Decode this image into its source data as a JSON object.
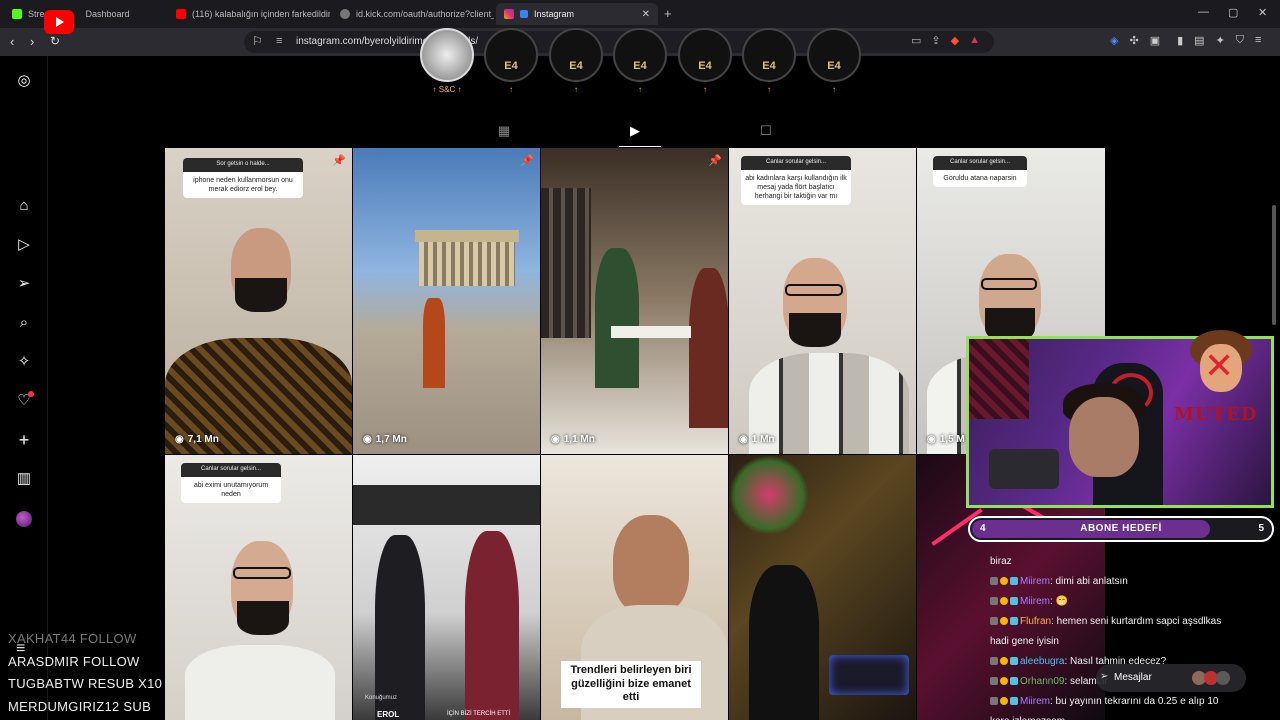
{
  "browser": {
    "tabs": [
      {
        "label": "Strea",
        "label2": "Dashboard",
        "favicon_color": "#53fc18"
      },
      {
        "label": "(116) kalabalığın içinden farkedildin -",
        "favicon_color": "#ff0000"
      },
      {
        "label": "id.kick.com/oauth/authorize?client_id",
        "favicon_color": "#888888"
      },
      {
        "label": "Instagram",
        "favicon_color": "#e1306c"
      }
    ],
    "close_glyph": "✕",
    "new_tab_glyph": "+",
    "url": "instagram.com/byerolyildirimofficial/reels/",
    "window_controls": [
      "—",
      "▢",
      "✕"
    ]
  },
  "instagram": {
    "sidebar_icons": [
      "instagram-icon",
      "home-icon",
      "reels-icon",
      "direct-icon",
      "search-icon",
      "explore-icon",
      "heart-icon",
      "create-icon",
      "dashboard-icon"
    ],
    "highlights": [
      {
        "label": "S&C",
        "cover": ""
      },
      {
        "label": "",
        "cover": "E4"
      },
      {
        "label": "",
        "cover": "E4"
      },
      {
        "label": "",
        "cover": "E4"
      },
      {
        "label": "",
        "cover": "E4"
      },
      {
        "label": "",
        "cover": "E4"
      },
      {
        "label": "",
        "cover": "E4"
      }
    ],
    "profile_tabs": [
      "posts-tab",
      "reels-tab",
      "tagged-tab"
    ],
    "reels": [
      {
        "views": "7,1 Mn",
        "pinned": true,
        "card_head": "Sor getsin o halde...",
        "card_text": "iphone neden kullanmorsun onu merak ediorz erol bey."
      },
      {
        "views": "1,7 Mn",
        "pinned": true,
        "card_head": "",
        "card_text": ""
      },
      {
        "views": "1,1 Mn",
        "pinned": true,
        "card_head": "",
        "card_text": ""
      },
      {
        "views": "1 Mn",
        "pinned": false,
        "card_head": "Canlar sorular gelsin...",
        "card_text": "abi kadınlara karşı kullandığın ilk mesaj yada flört başlatıcı herhangi bir taktiğin var mı"
      },
      {
        "views": "1,5 M",
        "pinned": false,
        "card_head": "Canlar sorular gelsin...",
        "card_text": "Goruldu atana naparsin"
      },
      {
        "views": "",
        "pinned": false,
        "card_head": "Canlar sorular gelsin...",
        "card_text": "abi eximi unutamıyorum neden"
      },
      {
        "views": "",
        "pinned": false,
        "card_head": "",
        "card_text": "",
        "small_text": "Konuğumuz",
        "name_text": "EROL",
        "right_text": "İÇİN BİZİ TERCİH ETTİ"
      },
      {
        "views": "",
        "pinned": false,
        "card_head": "",
        "card_text": "",
        "banner": "Trendleri belirleyen biri güzelliğini bize emanet etti"
      },
      {
        "views": "",
        "pinned": false,
        "card_head": "",
        "card_text": ""
      },
      {
        "views": "",
        "pinned": false,
        "card_head": "",
        "card_text": ""
      }
    ]
  },
  "stream": {
    "muted_text": "MUTED",
    "goal": {
      "title": "ABONE HEDEFİ",
      "current": "4",
      "target": "5",
      "progress": 0.8
    },
    "chat": [
      {
        "user": "",
        "user_color": "#ffffff",
        "text": "biraz"
      },
      {
        "user": "Miirem",
        "user_color": "#b07cff",
        "text": ": dimi abi anlatsın"
      },
      {
        "user": "Miirem",
        "user_color": "#b07cff",
        "text": ": 😁"
      },
      {
        "user": "Flufran",
        "user_color": "#ffb347",
        "text": ": hemen seni kurtardım sapci aşsdlkas"
      },
      {
        "user": "",
        "user_color": "#ffffff",
        "text": "hadi gene iyisin"
      },
      {
        "user": "aleebugra",
        "user_color": "#4fc3f7",
        "text": ": Nasıl tahmin edecez?"
      },
      {
        "user": "Orhann09",
        "user_color": "#66bb6a",
        "text": ": selamlar"
      },
      {
        "user": "Miirem",
        "user_color": "#b07cff",
        "text": ": bu yayının tekrarını da 0.25 e alıp 10"
      },
      {
        "user": "",
        "user_color": "#ffffff",
        "text": "kere izlemezsem..."
      }
    ],
    "messages_label": "Mesajlar",
    "events": [
      {
        "text": "XAKHAT44  FOLLOW",
        "faded": true
      },
      {
        "text": "ARASDMIR  FOLLOW",
        "faded": false
      },
      {
        "text": "TUGBABTW  RESUB X10",
        "faded": false
      },
      {
        "text": "MERDUMGIRIZ12  SUB",
        "faded": false
      }
    ]
  }
}
